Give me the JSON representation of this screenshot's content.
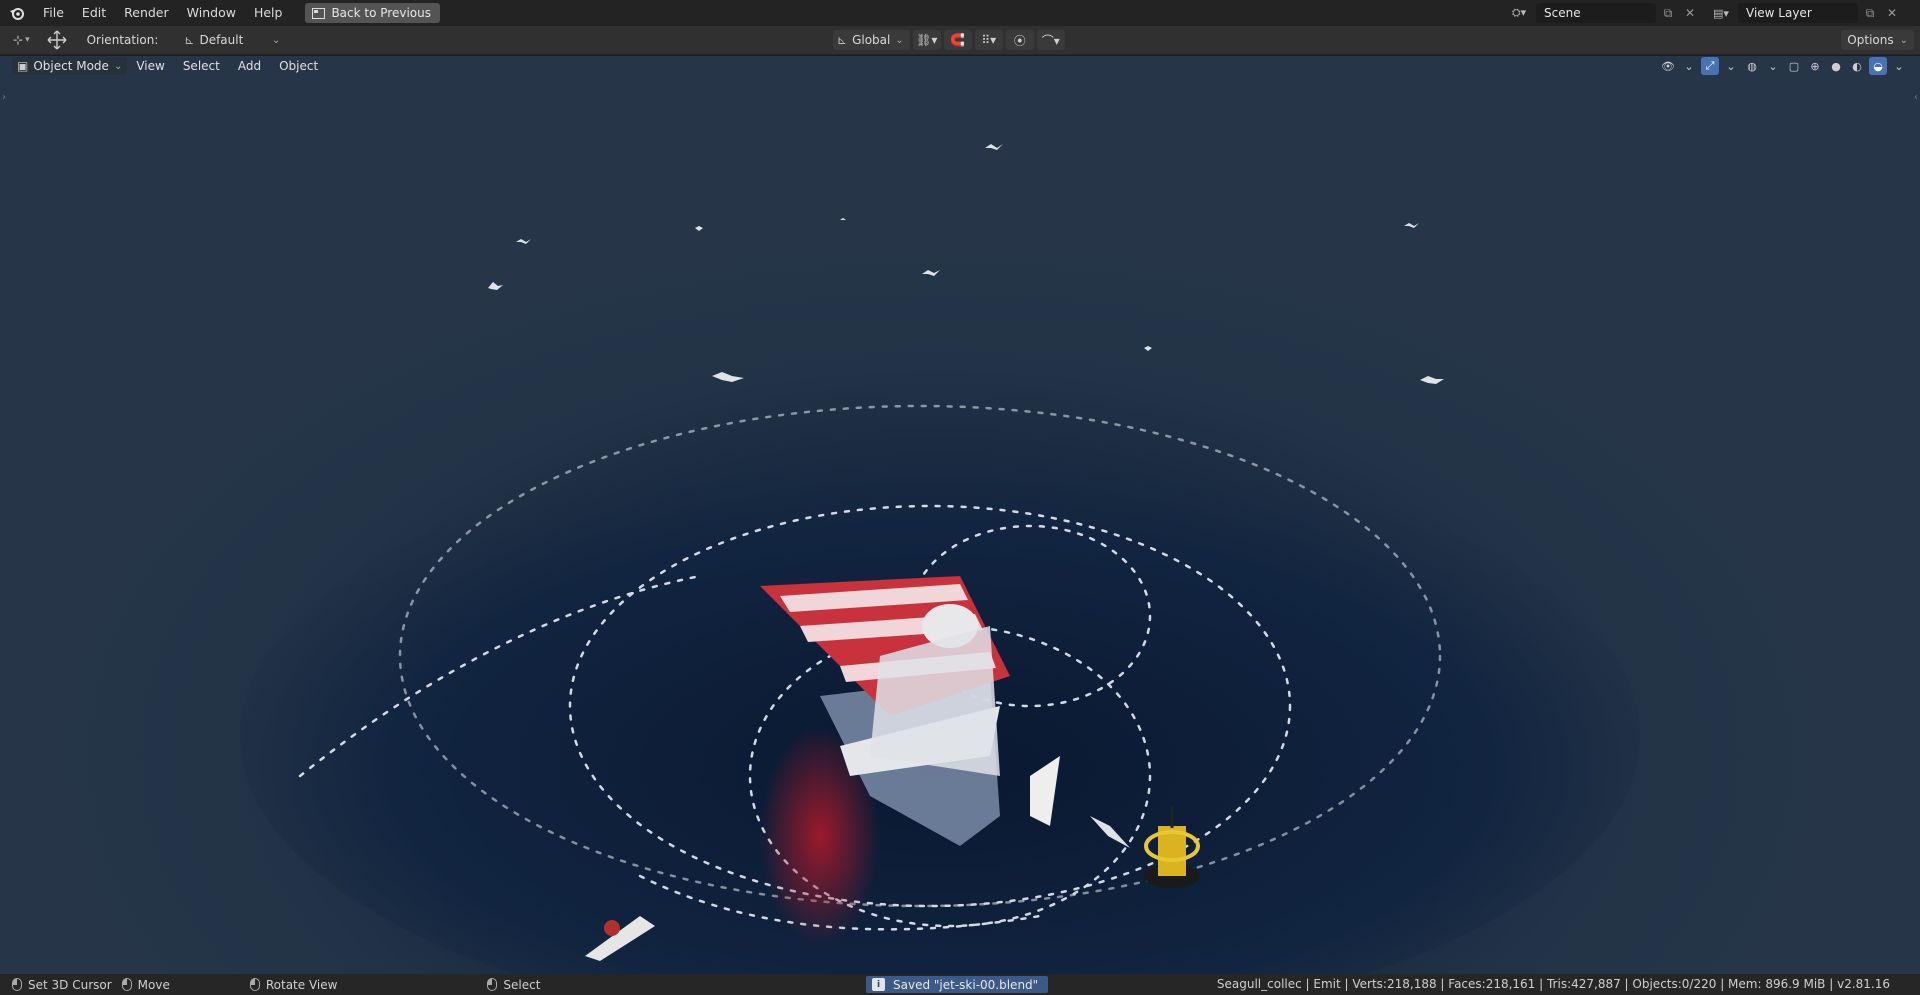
{
  "menu": {
    "items": [
      "File",
      "Edit",
      "Render",
      "Window",
      "Help"
    ],
    "back_button": "Back to Previous"
  },
  "scene": {
    "name": "Scene",
    "view_layer": "View Layer"
  },
  "toolheader": {
    "orientation_label": "Orientation:",
    "orientation_value": "Default",
    "transform_orientation": "Global",
    "options_label": "Options"
  },
  "viewport": {
    "mode": "Object Mode",
    "menus": [
      "View",
      "Select",
      "Add",
      "Object"
    ],
    "shading_active": "rendered"
  },
  "statusbar": {
    "hint_cursor": "Set 3D Cursor",
    "hint_move": "Move",
    "hint_rotate": "Rotate View",
    "hint_select": "Select",
    "saved_message": "Saved \"jet-ski-00.blend\"",
    "stats": "Seagull_collec | Emit | Verts:218,188 | Faces:218,161 | Tris:427,887 | Objects:0/220 | Mem: 896.9 MiB | v2.81.16"
  },
  "colors": {
    "accent": "#4772b3",
    "header": "#303030",
    "topbar": "#232323",
    "sail_red": "#c8323c",
    "buoy_yellow": "#d9b420"
  },
  "icons": [
    "blender-logo-icon",
    "transform-tool-icon",
    "snap-icon",
    "proportional-icon",
    "viewport-shading-icon"
  ]
}
